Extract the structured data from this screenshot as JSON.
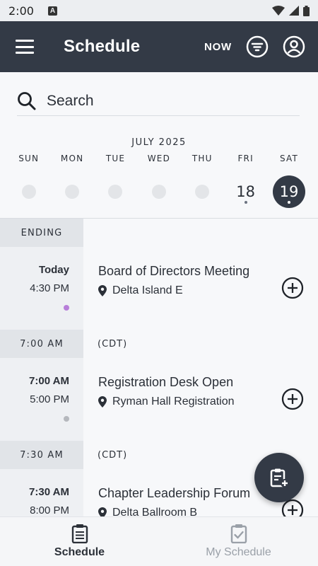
{
  "status_bar": {
    "time": "2:00",
    "notification_icon": "A"
  },
  "app_bar": {
    "title": "Schedule",
    "now_label": "NOW"
  },
  "search": {
    "placeholder": "Search"
  },
  "calendar": {
    "month_label": "JULY 2025",
    "weekdays": [
      "SUN",
      "MON",
      "TUE",
      "WED",
      "THU",
      "FRI",
      "SAT"
    ],
    "days": [
      {
        "label": "",
        "has_events": false,
        "selected": false
      },
      {
        "label": "",
        "has_events": false,
        "selected": false
      },
      {
        "label": "",
        "has_events": false,
        "selected": false
      },
      {
        "label": "",
        "has_events": false,
        "selected": false
      },
      {
        "label": "",
        "has_events": false,
        "selected": false
      },
      {
        "label": "18",
        "has_events": true,
        "selected": false
      },
      {
        "label": "19",
        "has_events": true,
        "selected": true
      }
    ]
  },
  "sections": [
    {
      "label": "ENDING",
      "timezone": "",
      "events": [
        {
          "time_start": "Today",
          "time_end": "4:30 PM",
          "title": "Board of Directors Meeting",
          "location": "Delta Island E",
          "dot_color": "#b77ed9"
        }
      ]
    },
    {
      "label": "7:00 AM",
      "timezone": "(CDT)",
      "events": [
        {
          "time_start": "7:00 AM",
          "time_end": "5:00 PM",
          "title": "Registration Desk Open",
          "location": "Ryman Hall Registration",
          "dot_color": "#b5b8bd"
        }
      ]
    },
    {
      "label": "7:30 AM",
      "timezone": "(CDT)",
      "events": [
        {
          "time_start": "7:30 AM",
          "time_end": "8:00 PM",
          "title": "Chapter Leadership Forum",
          "location": "Delta Ballroom B",
          "dot_color": ""
        }
      ]
    }
  ],
  "bottom_nav": {
    "tabs": [
      {
        "label": "Schedule",
        "active": true
      },
      {
        "label": "My Schedule",
        "active": false
      }
    ]
  },
  "colors": {
    "primary": "#333a46",
    "background": "#f7f8fa",
    "time_column": "#eef0f3",
    "section_label": "#e1e4e8"
  }
}
